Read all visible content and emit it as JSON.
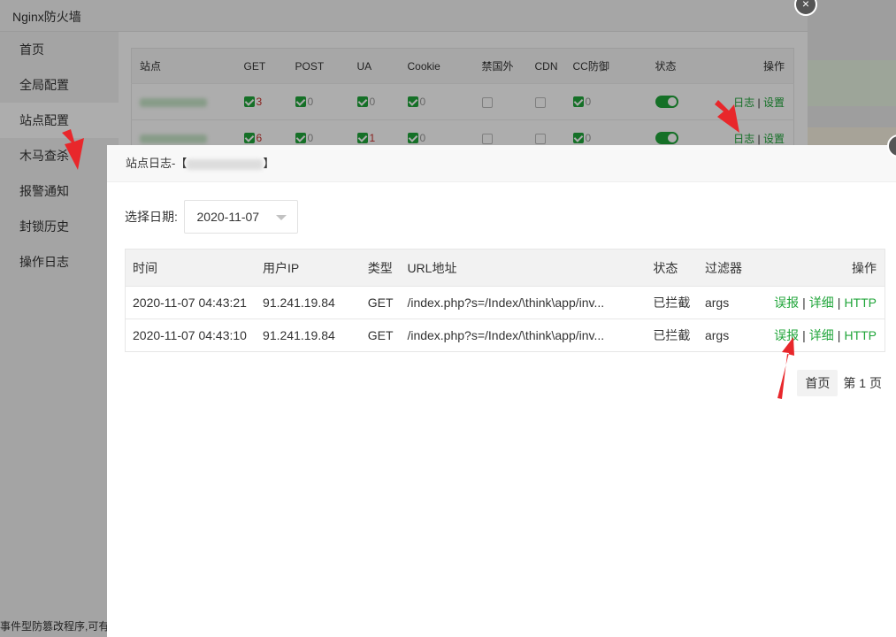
{
  "bg": {
    "window_title": "Nginx防火墙",
    "nav": [
      "首页",
      "全局配置",
      "站点配置",
      "木马查杀",
      "报警通知",
      "封锁历史",
      "操作日志"
    ],
    "table_headers": [
      "站点",
      "GET",
      "POST",
      "UA",
      "Cookie",
      "禁国外",
      "CDN",
      "CC防御",
      "状态",
      "操作"
    ],
    "rows": [
      {
        "site": "01.71.11.11",
        "get": "3",
        "post": "0",
        "ua": "0",
        "cookie": "0",
        "cc": "0"
      },
      {
        "site": "renaut.com",
        "get": "6",
        "post": "0",
        "ua": "1",
        "cookie": "0",
        "cc": "0"
      }
    ],
    "actions": {
      "log": "日志",
      "sep": "|",
      "settings": "设置"
    },
    "footer_text": "事件型防篡改程序,可有效"
  },
  "modal": {
    "title_prefix": "站点日志-【",
    "title_suffix": "】",
    "date_label": "选择日期:",
    "date_value": "2020-11-07",
    "headers": {
      "time": "时间",
      "ip": "用户IP",
      "type": "类型",
      "url": "URL地址",
      "status": "状态",
      "filter": "过滤器",
      "action": "操作"
    },
    "rows": [
      {
        "time": "2020-11-07 04:43:21",
        "ip": "91.241.19.84",
        "type": "GET",
        "url": "/index.php?s=/Index/\\think\\app/inv...",
        "status": "已拦截",
        "filter": "args"
      },
      {
        "time": "2020-11-07 04:43:10",
        "ip": "91.241.19.84",
        "type": "GET",
        "url": "/index.php?s=/Index/\\think\\app/inv...",
        "status": "已拦截",
        "filter": "args"
      }
    ],
    "row_actions": {
      "report": "误报",
      "detail": "详细",
      "http": "HTTP",
      "sep": "|"
    },
    "pager": {
      "first": "首页",
      "page": "第 1 页"
    }
  },
  "colors": {
    "green": "#20a53a",
    "red_arrow": "#e8272b"
  }
}
